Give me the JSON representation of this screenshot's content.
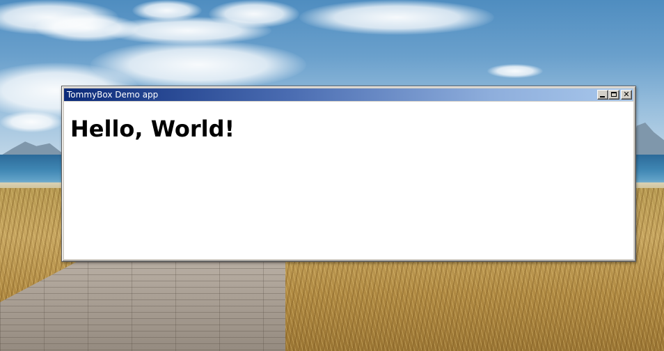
{
  "window": {
    "title": "TommyBox Demo app",
    "controls": {
      "minimize": "minimize-icon",
      "maximize": "maximize-icon",
      "close": "close-icon"
    },
    "titlebar_gradient": [
      "#0b2a79",
      "#a9c8ec"
    ]
  },
  "content": {
    "heading": "Hello, World!"
  },
  "colors": {
    "client_background": "#ffffff",
    "frame": "#d4d0c8"
  }
}
